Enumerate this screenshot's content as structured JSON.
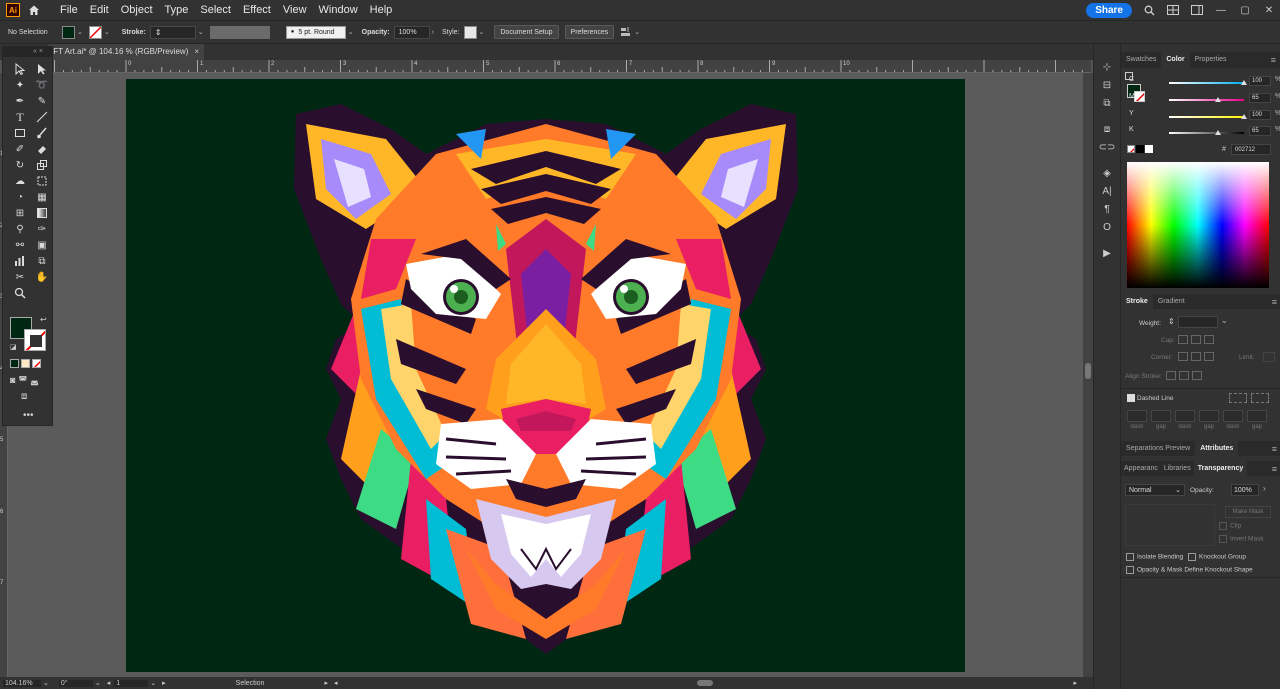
{
  "app": {
    "logo": "Ai",
    "menu": [
      "File",
      "Edit",
      "Object",
      "Type",
      "Select",
      "Effect",
      "View",
      "Window",
      "Help"
    ],
    "share_label": "Share"
  },
  "control": {
    "selection_label": "No Selection",
    "fill_color": "#002712",
    "stroke_label": "Stroke:",
    "brush_label": "5 pt. Round",
    "opacity_label": "Opacity:",
    "opacity_value": "100%",
    "style_label": "Style:",
    "doc_setup_label": "Document Setup",
    "preferences_label": "Preferences"
  },
  "document": {
    "tab_title": "IFT Art.ai* @ 104.16 % (RGB/Preview)",
    "close_symbol": "×",
    "artboard_color": "#002712"
  },
  "rulers": {
    "top": [
      "0",
      "1",
      "2",
      "3",
      "4",
      "5",
      "6",
      "7",
      "8",
      "9",
      "10"
    ],
    "left": [
      "1",
      "2",
      "3",
      "4",
      "5",
      "6",
      "7"
    ]
  },
  "status": {
    "zoom": "104.16%",
    "rotation": "0°",
    "artboard": "1",
    "tool": "Selection"
  },
  "color_panel": {
    "tabs": [
      "Swatches",
      "Color",
      "Properties"
    ],
    "active_tab": "Color",
    "channels": [
      {
        "label": "C",
        "value": "100",
        "frac": 1.0,
        "color": "#00aeef"
      },
      {
        "label": "M",
        "value": "65",
        "frac": 0.65,
        "color": "#ec008c"
      },
      {
        "label": "Y",
        "value": "100",
        "frac": 1.0,
        "color": "#fff200"
      },
      {
        "label": "K",
        "value": "65",
        "frac": 0.65,
        "color": "#000000"
      }
    ],
    "pct": "%",
    "hex_symbol": "#",
    "hex_value": "002712"
  },
  "stroke_panel": {
    "tabs": [
      "Stroke",
      "Gradient"
    ],
    "weight_label": "Weight:",
    "cap_label": "Cap:",
    "corner_label": "Corner:",
    "limit_label": "Limit:",
    "align_label": "Align Stroke:",
    "dashed_label": "Dashed Line",
    "dash_labels": [
      "dash",
      "gap",
      "dash",
      "gap",
      "dash",
      "gap"
    ]
  },
  "attr_panel": {
    "tabs": [
      "Separations Preview",
      "Attributes"
    ]
  },
  "transparency_panel": {
    "tabs": [
      "Appearanc",
      "Libraries",
      "Transparency"
    ],
    "blend_mode": "Normal",
    "opacity_label": "Opacity:",
    "opacity_value": "100%",
    "make_mask_label": "Make Mask",
    "clip_label": "Clip",
    "invert_label": "Invert Mask",
    "isolate_label": "Isolate Blending",
    "knockout_label": "Knockout Group",
    "opacity_mask_label": "Opacity & Mask Define Knockout Shape"
  }
}
